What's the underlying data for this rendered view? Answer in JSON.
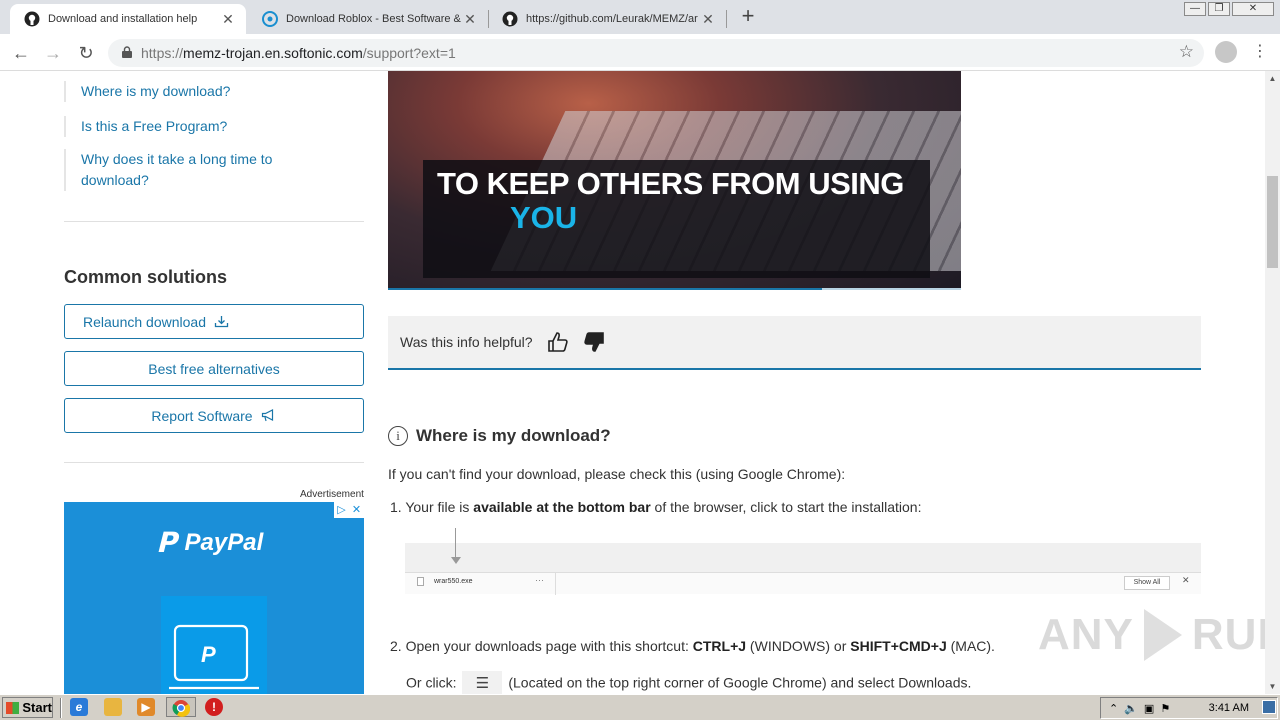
{
  "browser": {
    "tabs": [
      {
        "title": "Download and installation help",
        "close": "✕"
      },
      {
        "title": "Download Roblox - Best Software &",
        "close": "✕"
      },
      {
        "title": "https://github.com/Leurak/MEMZ/ar",
        "close": "✕"
      }
    ],
    "new_tab": "+",
    "window_controls": {
      "minimize": "—",
      "maximize": "❐",
      "close": "✕"
    },
    "nav": {
      "back": "←",
      "forward": "→",
      "reload": "↻",
      "menu": "⋮",
      "star": "☆"
    },
    "url": {
      "scheme": "https://",
      "host": "memz-trojan.en.softonic.com",
      "path": "/support?ext=1"
    }
  },
  "sidebar": {
    "faq_links": [
      {
        "label": "Where is my download?"
      },
      {
        "label": "Is this a Free Program?"
      },
      {
        "label": "Why does it take a long time to download?"
      }
    ],
    "common_solutions_title": "Common solutions",
    "buttons": [
      {
        "label": "Relaunch download",
        "icon": "download-icon"
      },
      {
        "label": "Best free alternatives"
      },
      {
        "label": "Report Software",
        "icon": "megaphone-icon"
      }
    ]
  },
  "ad": {
    "label": "Advertisement",
    "brand": "PayPal",
    "adchoices": "▷",
    "close": "✕"
  },
  "video": {
    "caption_line1": "TO KEEP OTHERS FROM USING",
    "caption_line2": "YOU",
    "progress": 0.758
  },
  "helpful": {
    "question": "Was this info helpful?",
    "thumbs_up": "👍",
    "thumbs_down": "👎"
  },
  "article": {
    "heading": "Where is my download?",
    "info_glyph": "i",
    "intro": "If you can't find your download, please check this (using Google Chrome):",
    "step1": {
      "num": "1.",
      "pre": "Your file is ",
      "bold": "available at the bottom bar",
      "post": " of the browser, click to start the installation:"
    },
    "shot": {
      "filename": "wrar550.exe",
      "dots": "···",
      "show_all": "Show All",
      "close": "✕"
    },
    "step2": {
      "num": "2.",
      "pre": "Open your downloads page with this shortcut: ",
      "k1": "CTRL+J",
      "mid": " (WINDOWS) or ",
      "k2": "SHIFT+CMD+J",
      "post": " (MAC)."
    },
    "step2b": {
      "pre": "Or click:",
      "menu_glyph": "☰",
      "post": "(Located on the top right corner of Google Chrome) and select Downloads."
    }
  },
  "watermark": {
    "left": "ANY",
    "right": "RUN"
  },
  "taskbar": {
    "start": "Start",
    "clock": "3:41 AM",
    "tray_icons": [
      "chevron-up-icon",
      "speaker-icon",
      "network-icon",
      "flag-icon"
    ]
  }
}
